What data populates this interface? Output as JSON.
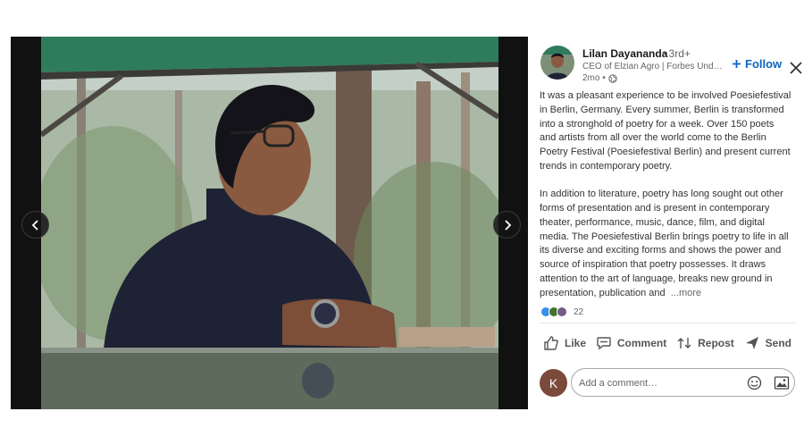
{
  "post": {
    "author": {
      "name": "Lilan Dayananda",
      "degree": "• 3rd+",
      "headline": "CEO of Elzian Agro | Forbes Under 30",
      "time": "2mo •"
    },
    "follow_label": "Follow",
    "paragraphs": [
      "It was a pleasant experience to be involved Poesiefestival in Berlin, Germany. Every summer, Berlin is transformed into a stronghold of poetry for a week. Over 150 poets and artists from all over the world come to the Berlin Poetry Festival (Poesiefestival Berlin) and present current trends in contemporary poetry.",
      "In addition to literature, poetry has long sought out other forms of presentation and is present in contemporary theater, performance, music, dance, film, and digital media. The Poesiefestival Berlin brings poetry to life in all its diverse and exciting forms and shows the power and source of inspiration that poetry possesses. It draws attention to the art of language, breaks new ground in presentation, publication and"
    ],
    "more_label": "...more",
    "reaction_count": "22"
  },
  "actions": {
    "like": "Like",
    "comment": "Comment",
    "repost": "Repost",
    "send": "Send"
  },
  "comment": {
    "avatar_initial": "K",
    "placeholder": "Add a comment…"
  },
  "icons": {
    "prev": "chevron-left-icon",
    "next": "chevron-right-icon",
    "close": "close-icon",
    "globe": "globe-icon",
    "emoji": "emoji-icon",
    "image": "image-icon"
  },
  "colors": {
    "accent": "#0a66c2",
    "like": "#378fe9",
    "celebrate": "#44712e",
    "support": "#715e86"
  }
}
